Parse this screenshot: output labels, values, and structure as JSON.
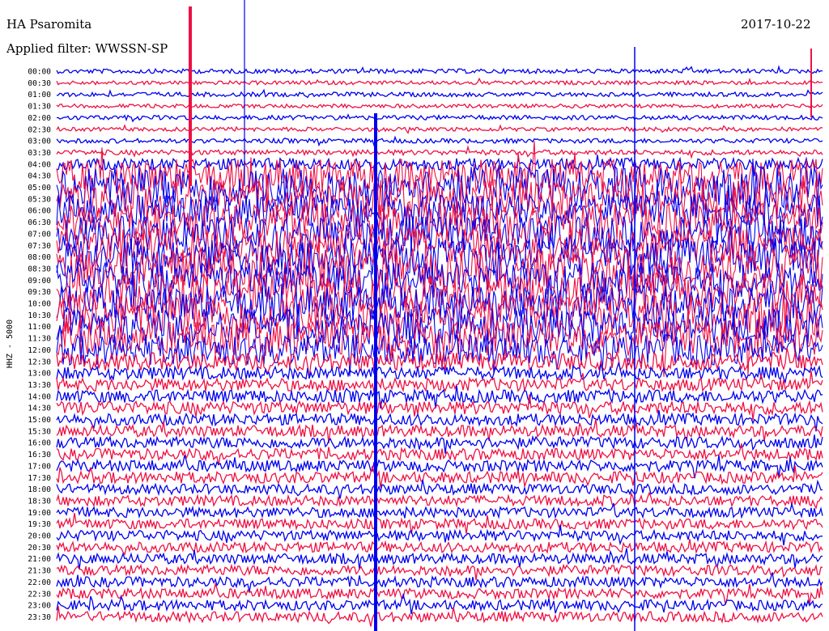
{
  "header": {
    "station": "HA Psaromita",
    "filter": "Applied filter: WWSSN-SP",
    "date": "2017-10-22"
  },
  "chart_data": {
    "type": "line",
    "title": "HA Psaromita",
    "subtitle": "Applied filter: WWSSN-SP",
    "ylabel": "HHZ - 5000",
    "rows": [
      "00:00",
      "00:30",
      "01:00",
      "01:30",
      "02:00",
      "02:30",
      "03:00",
      "03:30",
      "04:00",
      "04:30",
      "05:00",
      "05:30",
      "06:00",
      "06:30",
      "07:00",
      "07:30",
      "08:00",
      "08:30",
      "09:00",
      "09:30",
      "10:00",
      "10:30",
      "11:00",
      "11:30",
      "12:00",
      "12:30",
      "13:00",
      "13:30",
      "14:00",
      "14:30",
      "15:00",
      "15:30",
      "16:00",
      "16:30",
      "17:00",
      "17:30",
      "18:00",
      "18:30",
      "19:00",
      "19:30",
      "20:00",
      "20:30",
      "21:00",
      "21:30",
      "22:00",
      "22:30",
      "23:00",
      "23:30"
    ],
    "colors": [
      "#0000ee",
      "#ee1144"
    ],
    "noise_level": [
      0.35,
      0.3,
      0.35,
      0.3,
      0.35,
      0.3,
      0.35,
      0.4,
      0.9,
      2.6,
      3.2,
      3.0,
      2.6,
      3.0,
      2.8,
      2.8,
      3.0,
      3.2,
      2.8,
      3.0,
      2.8,
      3.2,
      2.8,
      2.8,
      2.4,
      1.4,
      1.0,
      1.0,
      1.0,
      1.0,
      0.9,
      0.9,
      0.9,
      0.9,
      0.9,
      0.9,
      0.8,
      0.8,
      0.8,
      0.8,
      0.8,
      0.8,
      0.8,
      0.8,
      0.8,
      0.8,
      0.8,
      0.8
    ],
    "grid": false
  }
}
